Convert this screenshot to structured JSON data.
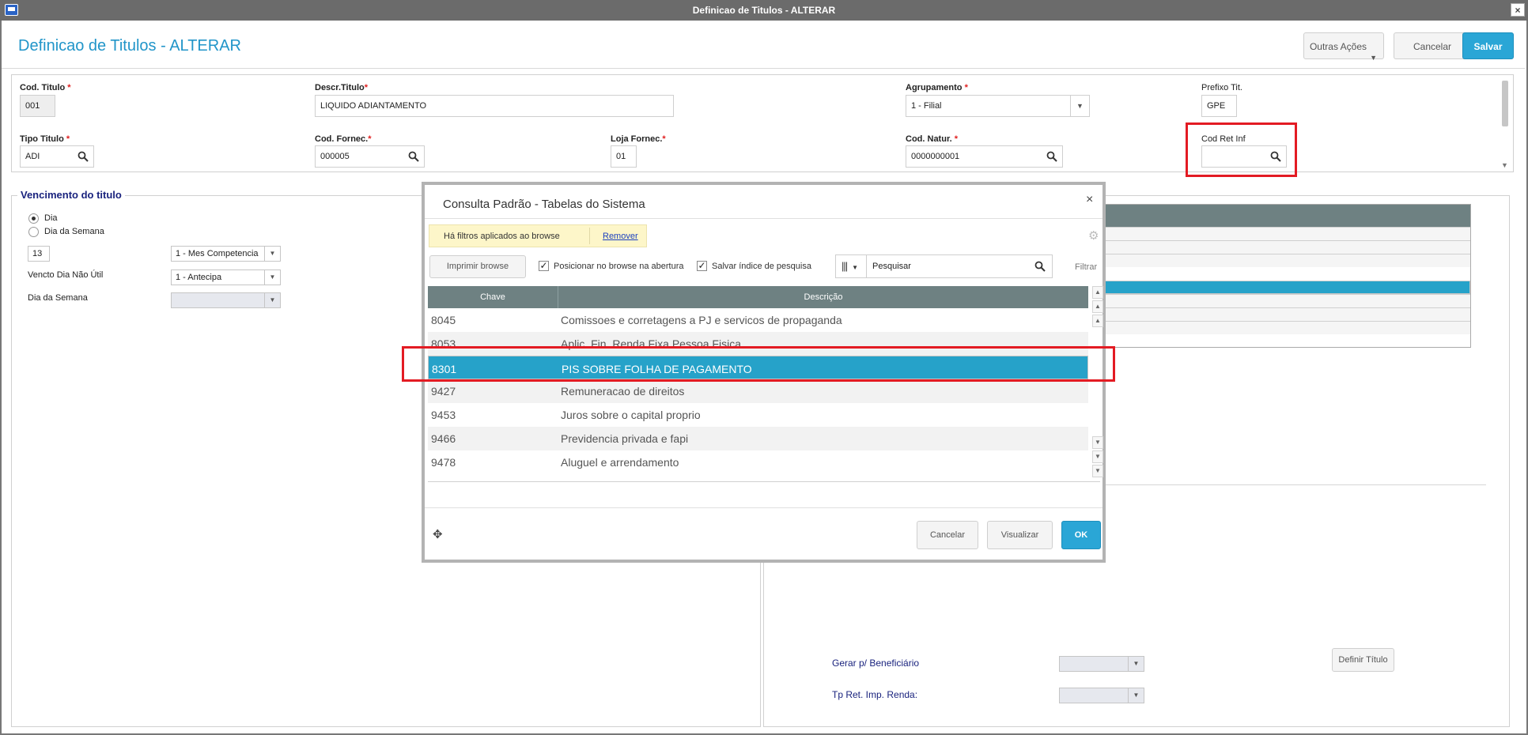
{
  "window": {
    "title": "Definicao de Titulos - ALTERAR",
    "close_glyph": "×"
  },
  "header": {
    "title": "Definicao de Titulos - ALTERAR",
    "outras_acoes_label": "Outras Ações",
    "cancelar_label": "Cancelar",
    "salvar_label": "Salvar"
  },
  "form": {
    "cod_titulo": {
      "label": "Cod. Titulo",
      "value": "001"
    },
    "descr_titulo": {
      "label": "Descr.Titulo",
      "value": "LIQUIDO ADIANTAMENTO"
    },
    "agrupamento": {
      "label": "Agrupamento",
      "value": "1 - Filial"
    },
    "prefixo_tit": {
      "label": "Prefixo Tit.",
      "value": "GPE"
    },
    "tipo_titulo": {
      "label": "Tipo Titulo",
      "value": "ADI"
    },
    "cod_fornec": {
      "label": "Cod. Fornec.",
      "value": "000005"
    },
    "loja_fornec": {
      "label": "Loja Fornec.",
      "value": "01"
    },
    "cod_natur": {
      "label": "Cod. Natur.",
      "value": "0000000001"
    },
    "cod_ret_inf": {
      "label": "Cod Ret Inf",
      "value": ""
    },
    "required_mark": "*"
  },
  "vencimento": {
    "legend": "Vencimento do titulo",
    "radio_dia": "Dia",
    "radio_dia_semana": "Dia da Semana",
    "dia_value": "13",
    "competencia_value": "1 - Mes Competencia",
    "vencto_label": "Vencto Dia Não Útil",
    "vencto_value": "1 - Antecipa",
    "dia_semana_label": "Dia da Semana"
  },
  "right_panel": {
    "gerar_label": "Gerar p/ Beneficiário",
    "tp_ret_label": "Tp Ret. Imp. Renda:",
    "definir_label": "Definir Título"
  },
  "dialog": {
    "title": "Consulta Padrão - Tabelas do Sistema",
    "close_glyph": "×",
    "filter_note": "Há filtros aplicados ao browse",
    "remover_label": "Remover",
    "imprimir_label": "Imprimir browse",
    "posicionar_label": "Posicionar no browse na abertura",
    "salvar_indice_label": "Salvar índice de pesquisa",
    "search_placeholder": "Pesquisar",
    "filtrar_label": "Filtrar",
    "columns": [
      "Chave",
      "Descrição"
    ],
    "rows": [
      {
        "chave": "8045",
        "descricao": "Comissoes e corretagens a PJ e servicos de propaganda"
      },
      {
        "chave": "8053",
        "descricao": "Aplic. Fin. Renda Fixa Pessoa Fisica"
      },
      {
        "chave": "8301",
        "descricao": "PIS SOBRE FOLHA DE PAGAMENTO"
      },
      {
        "chave": "9427",
        "descricao": "Remuneracao de direitos"
      },
      {
        "chave": "9453",
        "descricao": "Juros sobre o capital proprio"
      },
      {
        "chave": "9466",
        "descricao": "Previdencia privada e fapi"
      },
      {
        "chave": "9478",
        "descricao": "Aluguel e arrendamento"
      }
    ],
    "selected_row": 2,
    "cancelar_label": "Cancelar",
    "visualizar_label": "Visualizar",
    "ok_label": "OK"
  },
  "colors": {
    "accent": "#2195c9",
    "selection": "#26a2c9",
    "grid_header": "#6e8182",
    "highlight_box": "#e31b23"
  },
  "icons": [
    "app-icon",
    "search-icon",
    "dropdown-icon",
    "gear-icon",
    "move-icon",
    "columns-icon",
    "scroll-arrow-icon"
  ]
}
